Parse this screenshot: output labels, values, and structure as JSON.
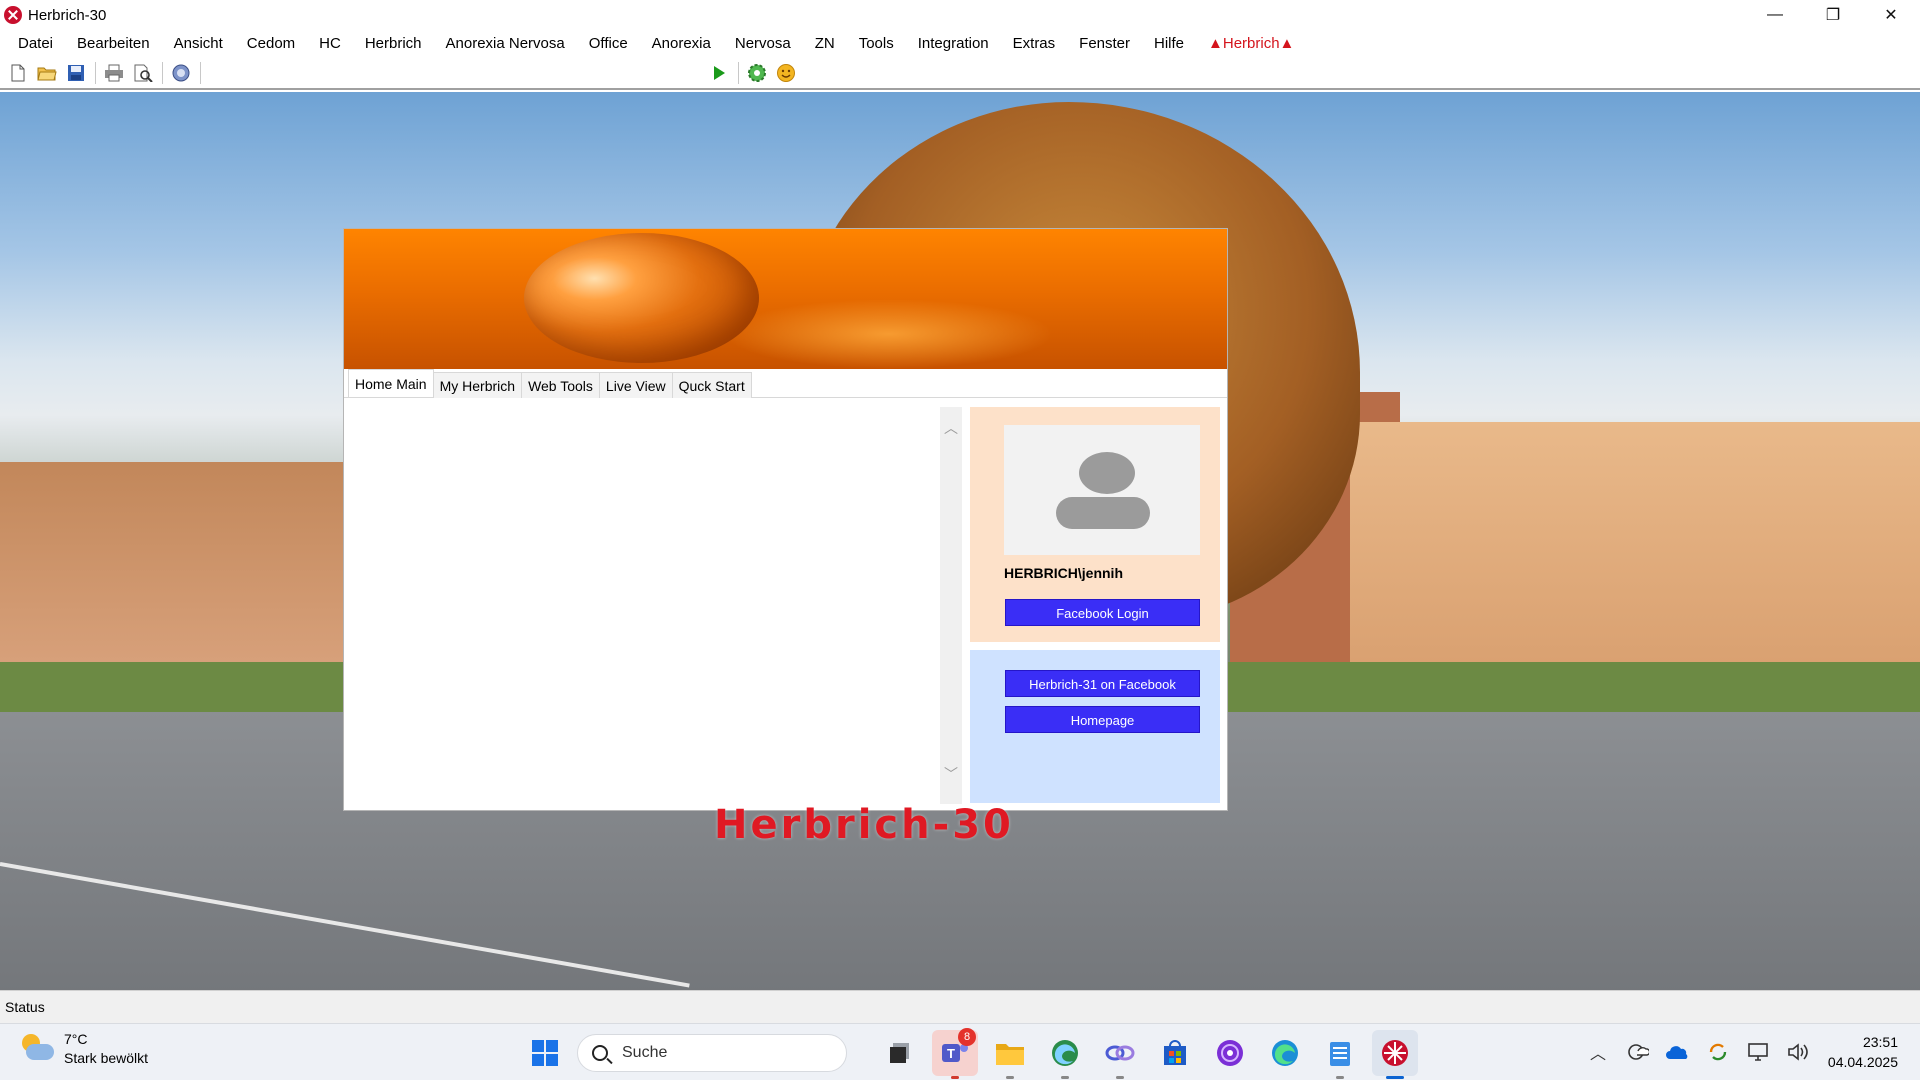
{
  "window": {
    "title": "Herbrich-30",
    "controls": {
      "minimize": "—",
      "restore": "❐",
      "close": "✕"
    }
  },
  "menu": {
    "items": [
      "Datei",
      "Bearbeiten",
      "Ansicht",
      "Cedom",
      "HC",
      "Herbrich",
      "Anorexia Nervosa",
      "Office",
      "Anorexia",
      "Nervosa",
      "ZN",
      "Tools",
      "Integration",
      "Extras",
      "Fenster",
      "Hilfe"
    ],
    "special": "▲Herbrich▲"
  },
  "toolbar": {
    "icons": [
      "new-file-icon",
      "open-folder-icon",
      "save-icon",
      "print-icon",
      "print-preview-icon",
      "web-icon",
      "play-icon",
      "settings-gear-icon",
      "emoji-icon"
    ]
  },
  "home": {
    "tabs": [
      "Home Main",
      "My Herbrich",
      "Web Tools",
      "Live View",
      "Quck Start"
    ],
    "active_tab": "Home Main",
    "username": "HERBRICH\\jennih",
    "facebook_login": "Facebook Login",
    "facebook_page": "Herbrich-31 on Facebook",
    "homepage": "Homepage",
    "colors": {
      "banner": "#ff7a00",
      "button": "#3a2ef6",
      "profile_panel": "#fde1c9",
      "links_panel": "#cfe2ff"
    }
  },
  "desktop": {
    "overlay_title": "Herbrich-30",
    "overlay_color": "#e01923"
  },
  "statusbar": {
    "text": "Status"
  },
  "taskbar": {
    "weather": {
      "temp": "7°C",
      "condition": "Stark bewölkt"
    },
    "search_placeholder": "Suche",
    "apps": [
      "windows-start-icon",
      "task-view-icon",
      "teams-icon",
      "file-explorer-icon",
      "edge-dev-icon",
      "copilot-icon",
      "store-icon",
      "podcast-icon",
      "edge-icon",
      "notepad-icon",
      "herbrich-app-icon"
    ],
    "teams_badge": "8",
    "clock": {
      "time": "23:51",
      "date": "04.04.2025"
    }
  }
}
